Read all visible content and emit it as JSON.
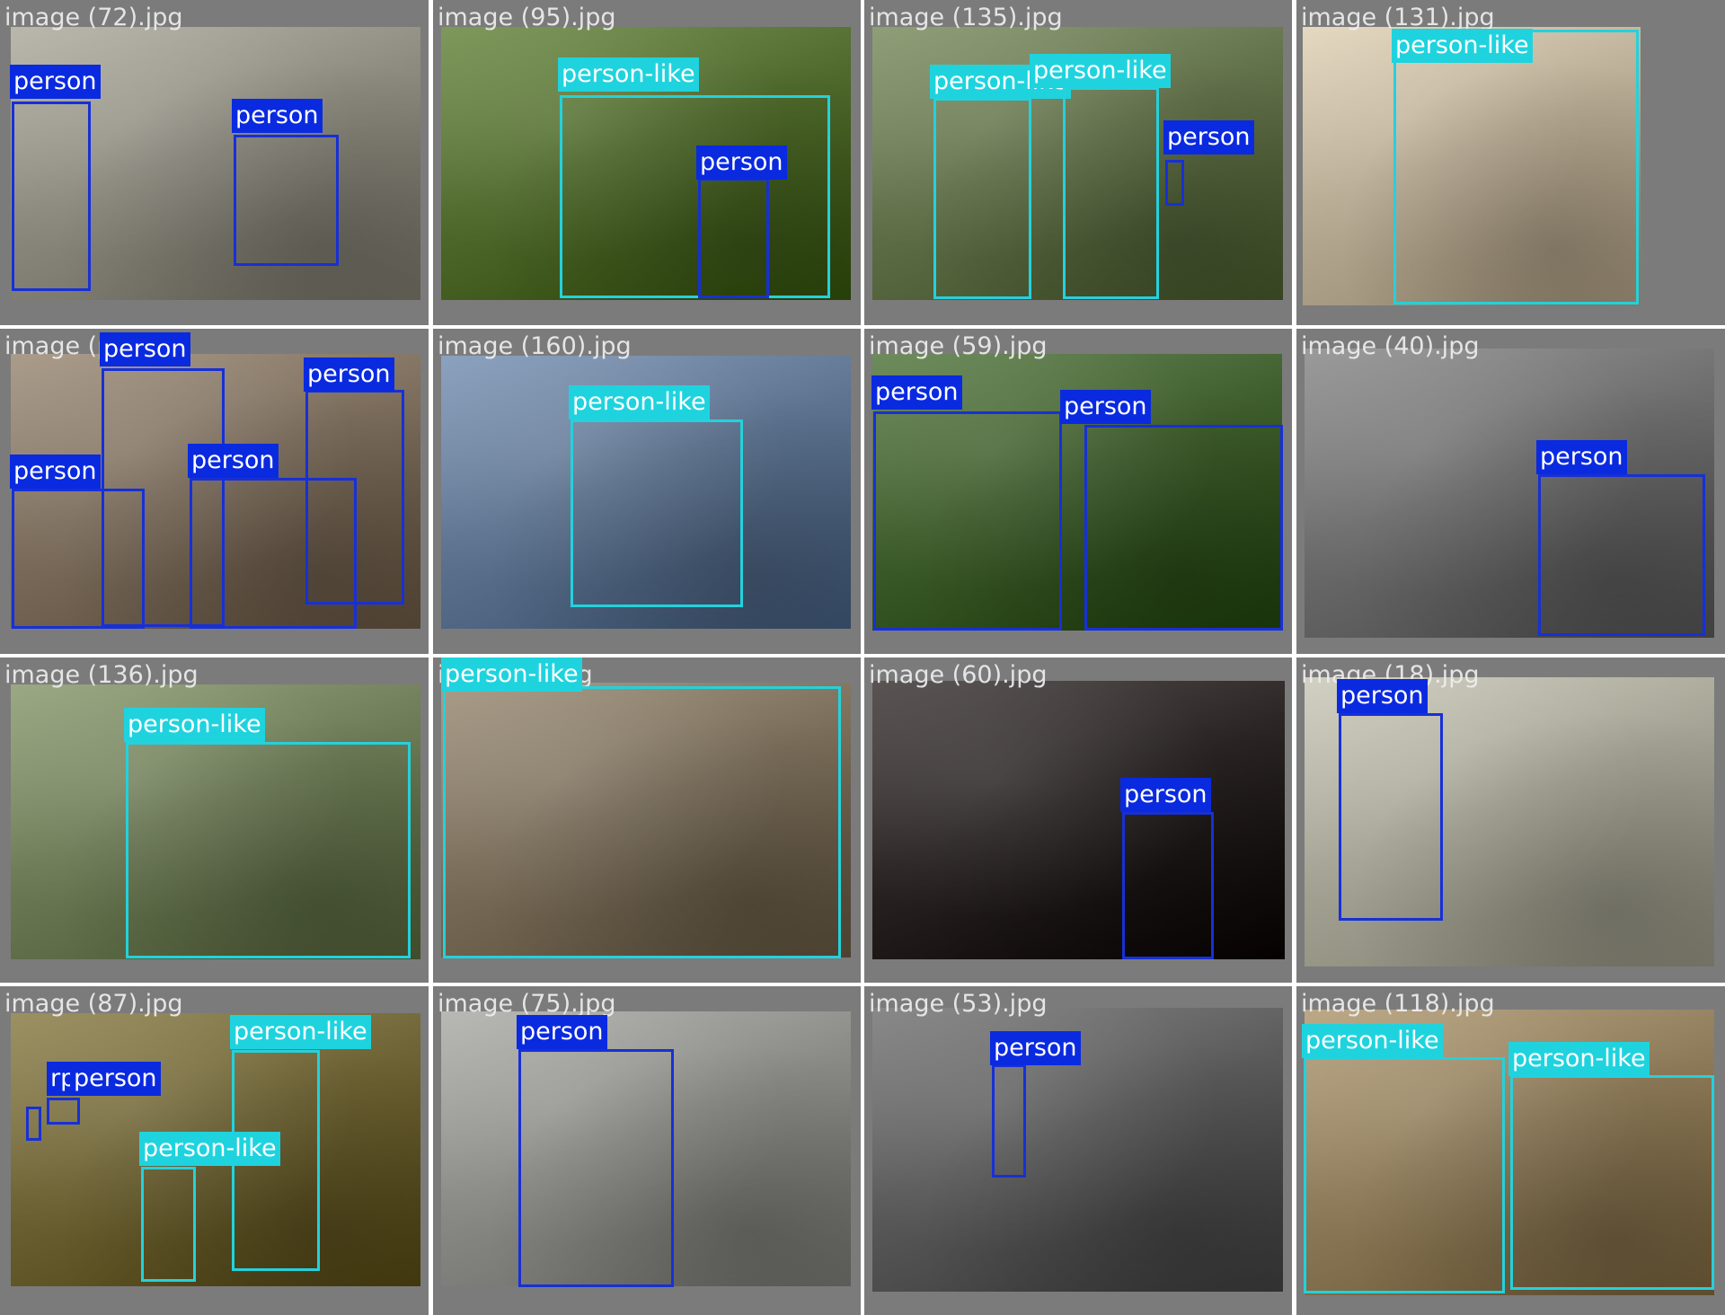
{
  "colors": {
    "tile_background": "#7b7b7b",
    "person_box": "#1730d6",
    "person_label": "#0a2ae0",
    "person_like_box": "#24d1dc",
    "person_like_label": "#1fd3de"
  },
  "tiles": [
    {
      "filename": "image (72).jpg",
      "tone": "#8c8a7e",
      "detections": [
        {
          "cls": "person",
          "label": "person"
        },
        {
          "cls": "person",
          "label": "person"
        }
      ]
    },
    {
      "filename": "image (95).jpg",
      "tone": "#4f6a2c",
      "detections": [
        {
          "cls": "person-like",
          "label": "person-like"
        },
        {
          "cls": "person",
          "label": "person"
        }
      ]
    },
    {
      "filename": "image (135).jpg",
      "tone": "#607048",
      "detections": [
        {
          "cls": "person-like",
          "label": "person-like"
        },
        {
          "cls": "person-like",
          "label": "person-like"
        },
        {
          "cls": "person",
          "label": "person"
        }
      ]
    },
    {
      "filename": "image (131).jpg",
      "tone": "#b8ab93",
      "detections": [
        {
          "cls": "person-like",
          "label": "person-like"
        }
      ]
    },
    {
      "filename": "image (person",
      "tone": "#7c6d5c",
      "detections": [
        {
          "cls": "person",
          "label": "person"
        },
        {
          "cls": "person",
          "label": "person"
        },
        {
          "cls": "person",
          "label": "person"
        },
        {
          "cls": "person",
          "label": "person"
        }
      ]
    },
    {
      "filename": "image (160).jpg",
      "tone": "#5d7390",
      "detections": [
        {
          "cls": "person-like",
          "label": "person-like"
        }
      ]
    },
    {
      "filename": "image (59).jpg",
      "tone": "#3e5d2c",
      "detections": [
        {
          "cls": "person",
          "label": "person"
        },
        {
          "cls": "person",
          "label": "person"
        }
      ]
    },
    {
      "filename": "image (40).jpg",
      "tone": "#6c6c6c",
      "detections": [
        {
          "cls": "person",
          "label": "person"
        }
      ]
    },
    {
      "filename": "image (136).jpg",
      "tone": "#6c7a55",
      "detections": [
        {
          "cls": "person-like",
          "label": "person-like"
        }
      ]
    },
    {
      "filename": "image (   ).jpg",
      "tone": "#7a6e5a",
      "detections": [
        {
          "cls": "person-like",
          "label": "person-like"
        }
      ]
    },
    {
      "filename": "image (60).jpg",
      "tone": "#2a2424",
      "detections": [
        {
          "cls": "person",
          "label": "person"
        }
      ]
    },
    {
      "filename": "image (18).jpg",
      "tone": "#a4a394",
      "detections": [
        {
          "cls": "person",
          "label": "person"
        }
      ]
    },
    {
      "filename": "image (87).jpg",
      "tone": "#6d6233",
      "detections": [
        {
          "cls": "person-like",
          "label": "person-like"
        },
        {
          "cls": "person",
          "label": "rperson"
        },
        {
          "cls": "person",
          "label": "person"
        },
        {
          "cls": "person-like",
          "label": "person-like"
        }
      ]
    },
    {
      "filename": "image (75).jpg",
      "tone": "#8a8a86",
      "detections": [
        {
          "cls": "person",
          "label": "person"
        }
      ]
    },
    {
      "filename": "image (53).jpg",
      "tone": "#5a5a5a",
      "detections": [
        {
          "cls": "person",
          "label": "person"
        }
      ]
    },
    {
      "filename": "image (118).jpg",
      "tone": "#8d7a58",
      "detections": [
        {
          "cls": "person-like",
          "label": "person-like"
        },
        {
          "cls": "person-like",
          "label": "person-like"
        }
      ]
    }
  ]
}
